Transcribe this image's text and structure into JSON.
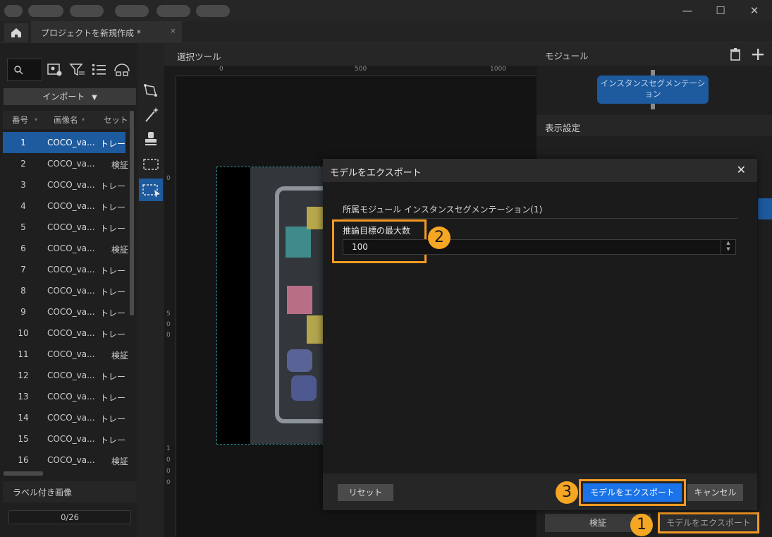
{
  "tabs": {
    "document": "プロジェクトを新規作成 *",
    "close": "×"
  },
  "left": {
    "import": "インポート",
    "columns": [
      "番号",
      "画像名",
      "セット"
    ],
    "rows": [
      {
        "num": "1",
        "name": "COCO_va...",
        "set": "トレー"
      },
      {
        "num": "2",
        "name": "COCO_va...",
        "set": "検証"
      },
      {
        "num": "3",
        "name": "COCO_va...",
        "set": "トレー"
      },
      {
        "num": "4",
        "name": "COCO_va...",
        "set": "トレー"
      },
      {
        "num": "5",
        "name": "COCO_va...",
        "set": "トレー"
      },
      {
        "num": "6",
        "name": "COCO_va...",
        "set": "検証"
      },
      {
        "num": "7",
        "name": "COCO_va...",
        "set": "トレー"
      },
      {
        "num": "8",
        "name": "COCO_va...",
        "set": "トレー"
      },
      {
        "num": "9",
        "name": "COCO_va...",
        "set": "トレー"
      },
      {
        "num": "10",
        "name": "COCO_va...",
        "set": "トレー"
      },
      {
        "num": "11",
        "name": "COCO_va...",
        "set": "検証"
      },
      {
        "num": "12",
        "name": "COCO_va...",
        "set": "トレー"
      },
      {
        "num": "13",
        "name": "COCO_va...",
        "set": "トレー"
      },
      {
        "num": "14",
        "name": "COCO_va...",
        "set": "トレー"
      },
      {
        "num": "15",
        "name": "COCO_va...",
        "set": "トレー"
      },
      {
        "num": "16",
        "name": "COCO_va...",
        "set": "検証"
      }
    ],
    "labeled_images": "ラベル付き画像",
    "progress": "0/26"
  },
  "canvas": {
    "title": "選択ツール",
    "ruler_top": [
      "0",
      "500",
      "1000"
    ],
    "ruler_left": [
      "0",
      "5",
      "0",
      "0",
      "1",
      "0",
      "0",
      "0"
    ]
  },
  "right": {
    "module_title": "モジュール",
    "module_node": "インスタンスセグメンテーション",
    "display_settings": "表示設定",
    "verify": "検証",
    "export_model": "モデルをエクスポート"
  },
  "dialog": {
    "title": "モデルをエクスポート",
    "close": "✕",
    "module_line": "所属モジュール インスタンスセグメンテーション(1)",
    "max_label": "推論目標の最大数",
    "max_value": "100",
    "reset": "リセット",
    "export": "モデルをエクスポート",
    "cancel": "キャンセル"
  },
  "badges": {
    "b1": "1",
    "b2": "2",
    "b3": "3"
  },
  "colors": {
    "accent": "#1a73e8",
    "highlight": "#f59a23",
    "selection": "#1e5a9e"
  }
}
